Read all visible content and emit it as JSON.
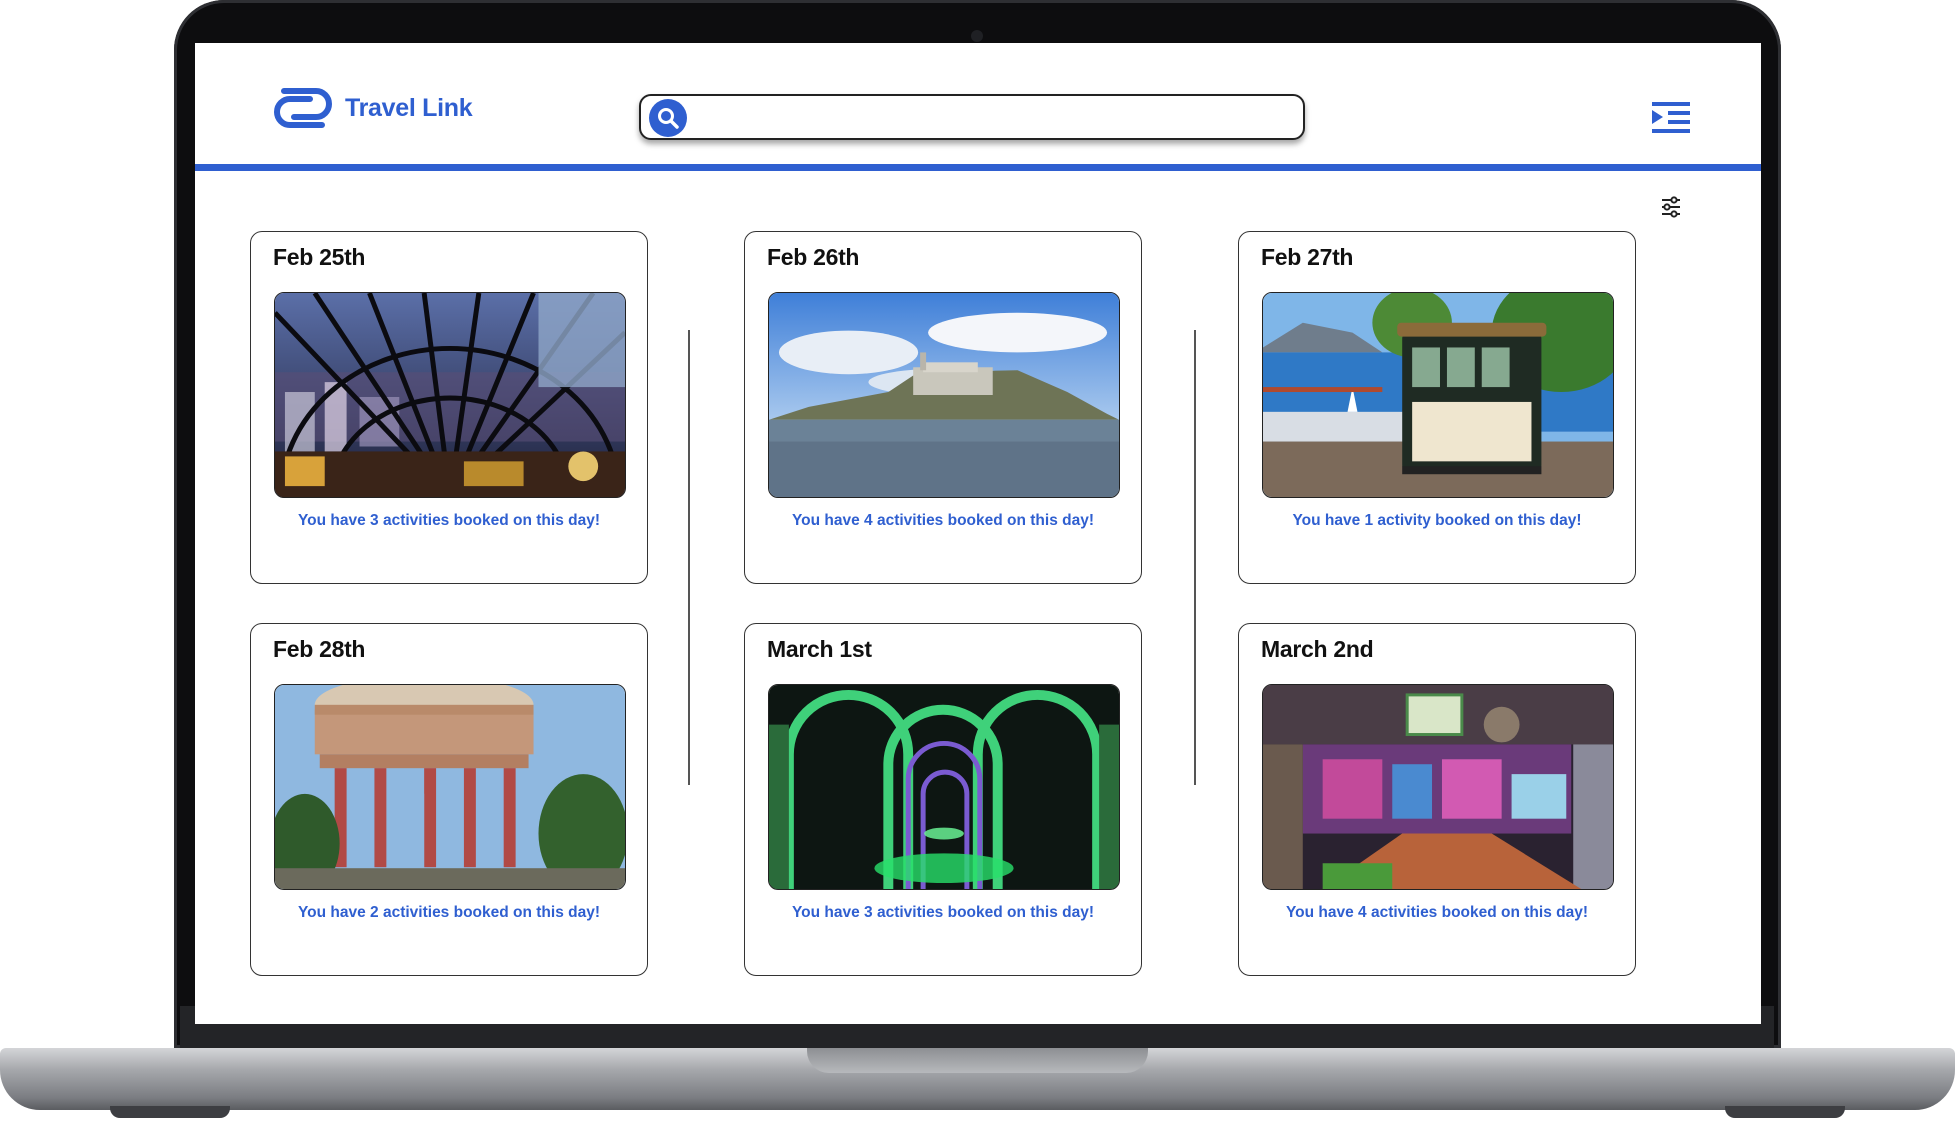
{
  "app": {
    "brand_name": "Travel Link",
    "accent_color": "#2f5fd0"
  },
  "search": {
    "placeholder": "",
    "value": "",
    "icon": "search-icon"
  },
  "header": {
    "menu_icon": "menu-icon",
    "filter_icon": "filter-sliders-icon"
  },
  "days": [
    {
      "date": "Feb 25th",
      "image": "rooftop-bar-photo",
      "summary": "You have 3 activities booked  on this day!"
    },
    {
      "date": "Feb 26th",
      "image": "alcatraz-island-photo",
      "summary": "You have 4 activities booked on this day!"
    },
    {
      "date": "Feb 27th",
      "image": "cable-car-photo",
      "summary": "You have 1 activity booked on this day!"
    },
    {
      "date": "Feb 28th",
      "image": "palace-of-fine-arts-photo",
      "summary": "You have 2 activities booked on this day!"
    },
    {
      "date": "March 1st",
      "image": "mirror-maze-photo",
      "summary": "You have 3 activities booked on this day!"
    },
    {
      "date": "March 2nd",
      "image": "museum-interior-photo",
      "summary": "You have 4 activities booked on this day!"
    }
  ]
}
